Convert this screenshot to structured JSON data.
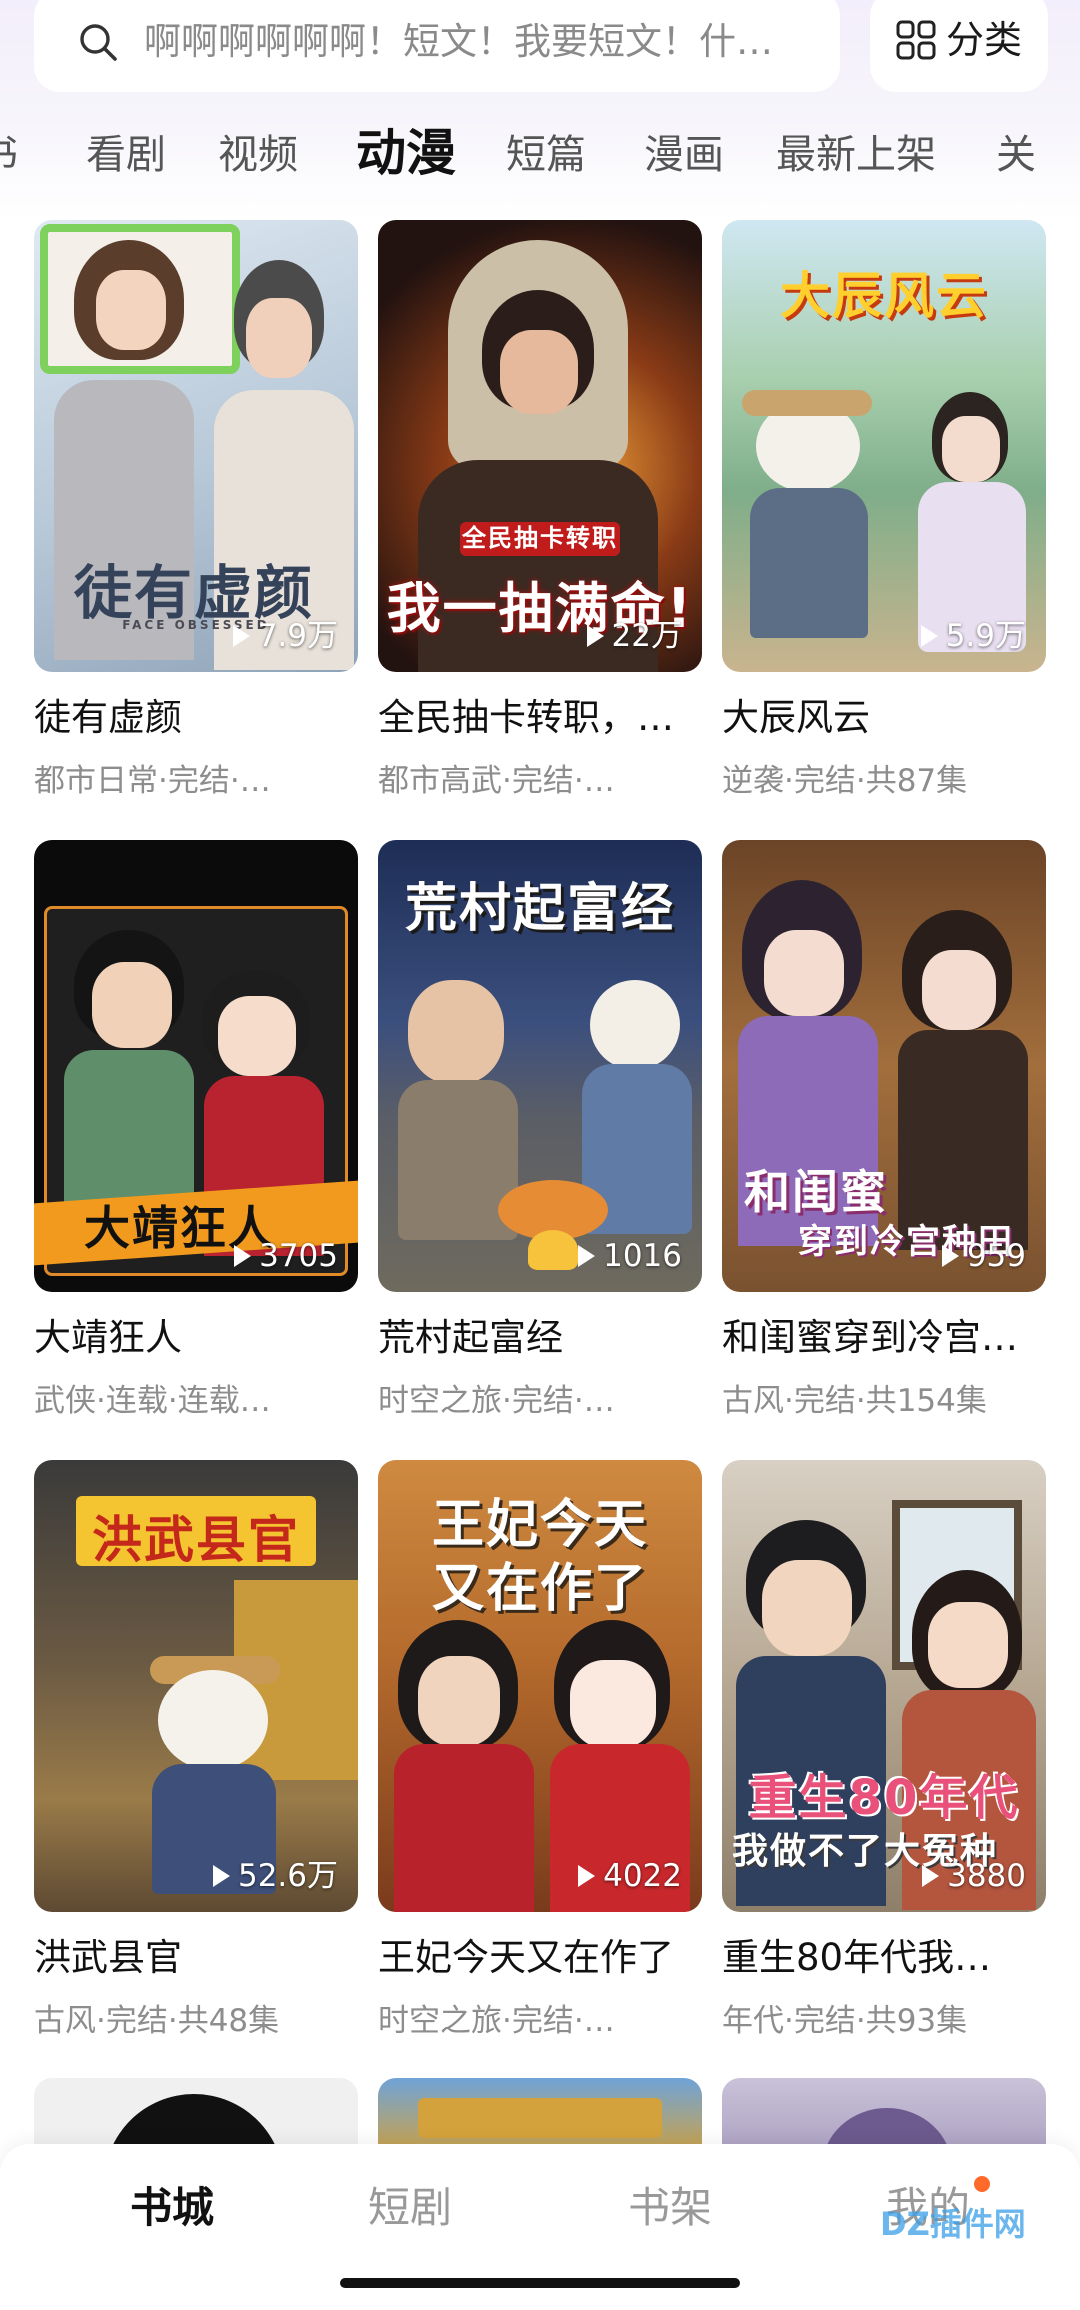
{
  "search": {
    "placeholder": "啊啊啊啊啊啊！短文！我要短文！什…",
    "icon": "search-icon"
  },
  "category_button": {
    "label": "分类",
    "icon": "grid-icon"
  },
  "tabs": [
    {
      "label": "书"
    },
    {
      "label": "看剧"
    },
    {
      "label": "视频"
    },
    {
      "label": "动漫",
      "active": true
    },
    {
      "label": "短篇"
    },
    {
      "label": "漫画"
    },
    {
      "label": "最新上架"
    },
    {
      "label": "关"
    }
  ],
  "cards": [
    {
      "name": "徒有虚颜",
      "meta": "都市日常·完结·…",
      "plays": "7.9万",
      "cover_text": "徒有虚颜",
      "cover_text2": "FACE OBSESSED"
    },
    {
      "name": "全民抽卡转职，…",
      "meta": "都市高武·完结·…",
      "plays": "22万",
      "cover_text": "我一抽满命!",
      "cover_text2": "全民抽卡转职"
    },
    {
      "name": "大辰风云",
      "meta": "逆袭·完结·共87集",
      "plays": "5.9万",
      "cover_text": "大辰风云"
    },
    {
      "name": "大靖狂人",
      "meta": "武侠·连载·连载…",
      "plays": "3705",
      "cover_text": "大靖狂人"
    },
    {
      "name": "荒村起富经",
      "meta": "时空之旅·完结·…",
      "plays": "1016",
      "cover_text": "荒村起富经"
    },
    {
      "name": "和闺蜜穿到冷宫…",
      "meta": "古风·完结·共154集",
      "plays": "959",
      "cover_text": "和闺蜜",
      "cover_text2": "穿到冷宫种田"
    },
    {
      "name": "洪武县官",
      "meta": "古风·完结·共48集",
      "plays": "52.6万",
      "cover_text": "洪武县官"
    },
    {
      "name": "王妃今天又在作了",
      "meta": "时空之旅·完结·…",
      "plays": "4022",
      "cover_text": "王妃今天",
      "cover_text2": "又在作了"
    },
    {
      "name": "重生80年代我…",
      "meta": "年代·完结·共93集",
      "plays": "3880",
      "cover_text": "重生80年代",
      "cover_text2": "我做不了大冤种"
    }
  ],
  "bottom_nav": [
    {
      "label": "书城",
      "active": true
    },
    {
      "label": "短剧"
    },
    {
      "label": "书架"
    },
    {
      "label": "我的",
      "badge": true
    }
  ],
  "watermark": "DZ插件网",
  "colors": {
    "accent_dot": "#ff6a2b",
    "meta_text": "#8d8d8d",
    "tab_inactive": "#555555"
  }
}
